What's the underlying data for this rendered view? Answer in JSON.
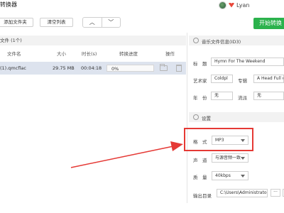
{
  "window": {
    "title": "转换器"
  },
  "user": {
    "name": "Lyan"
  },
  "toolbar": {
    "add_label": "添加文件夹",
    "clear_label": "清空列表",
    "up_label": "︿",
    "down_label": "﹀",
    "start_label": "开始转换"
  },
  "file_list": {
    "header": "文件 (1个)",
    "columns": [
      "文件名",
      "大小",
      "时长(s)",
      "转换进度",
      "操作"
    ],
    "rows": [
      {
        "name": "(1).qmcflac",
        "size": "29.75 MB",
        "duration": "00:04:18",
        "progress": "0%",
        "progress_value": 0
      }
    ]
  },
  "id3": {
    "section_title": "音乐文件信息(ID3)",
    "title_label": "标　题",
    "title_value": "Hymn For The Weekend",
    "artist_label": "艺术家",
    "artist_value": "Coldpl",
    "album_label": "专辑",
    "album_value": "A Head Full o",
    "year_label": "年　份",
    "year_value": "无",
    "genre_label": "流派",
    "genre_value": "无"
  },
  "settings": {
    "section_title": "设置",
    "format_label": "格　式",
    "format_value": "MP3",
    "channel_label": "声　道",
    "channel_value": "与源音频一致",
    "quality_label": "质　量",
    "quality_value": "40kbps",
    "output_label": "输出目录",
    "output_value": "C:\\Users\\Administrator",
    "more_label": "···"
  },
  "colors": {
    "accent_green": "#2bb24c",
    "highlight_red": "#e53935",
    "selected_row": "#dde3ee"
  }
}
